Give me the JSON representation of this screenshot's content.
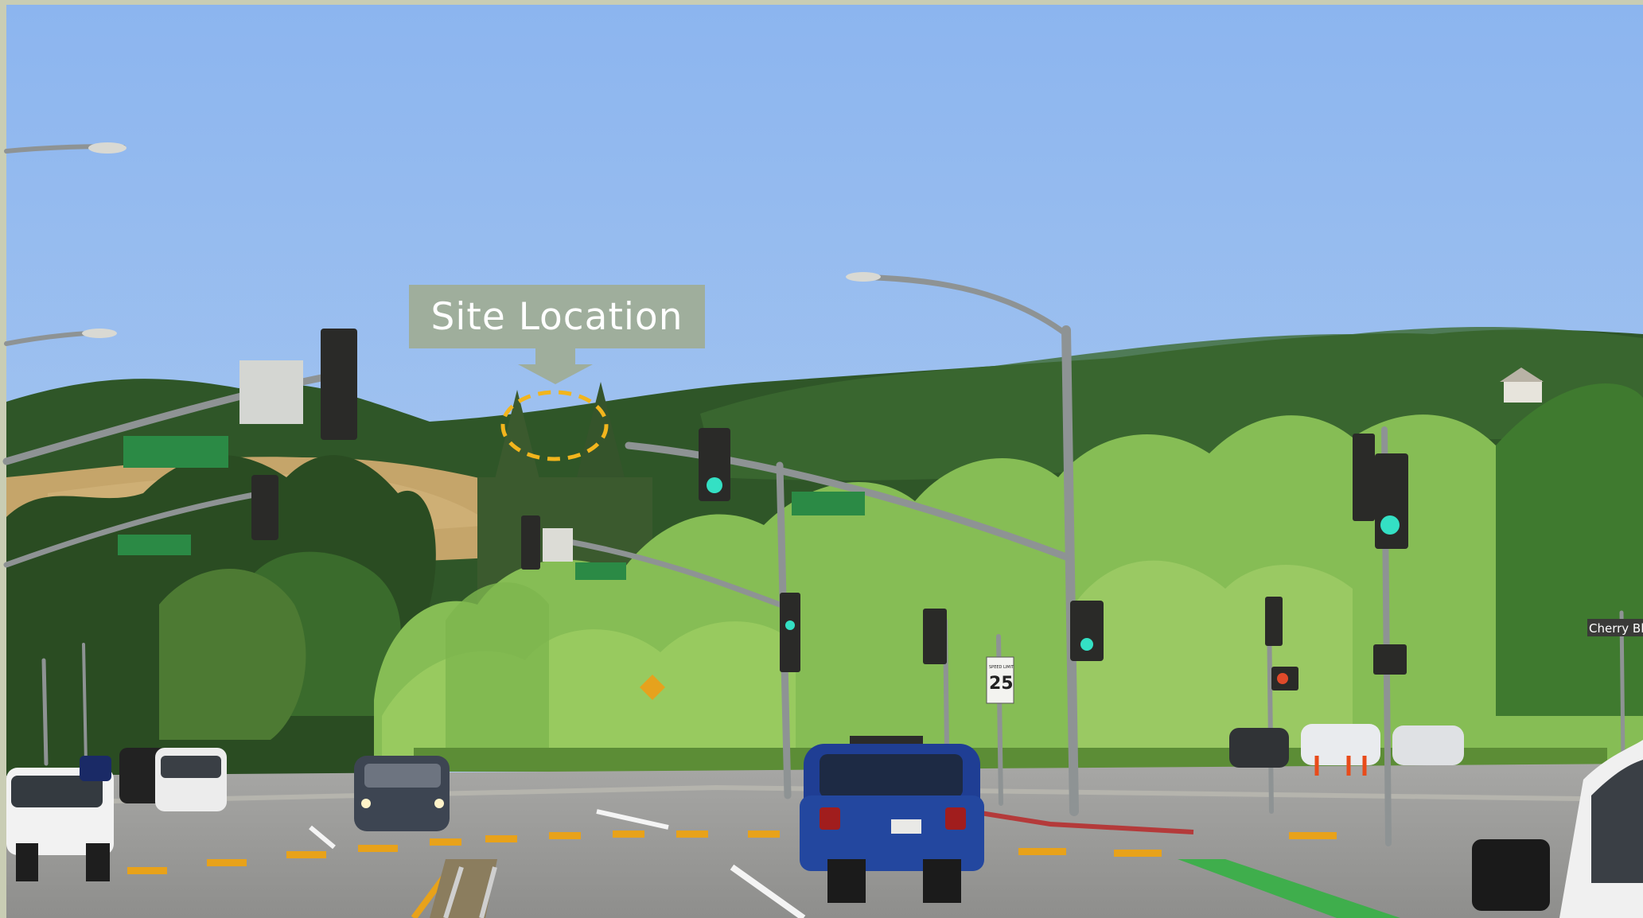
{
  "image": {
    "description_free": true,
    "colors": {
      "sky_top": "#8fb7f0",
      "sky_bottom": "#a9c8ee",
      "hill_dark": "#2f5a2a",
      "hill_dry": "#c9aa6b",
      "tree_light": "#8fc45a",
      "road": "#9a9a9a",
      "lane_yellow": "#e8a21a",
      "bike_lane": "#3fae4c",
      "callout_bg": "#9fae9c",
      "dashed_circle": "#f2b51d",
      "top_bar": "#c9cdb4"
    }
  },
  "callout": {
    "label": "Site Location"
  },
  "signs": {
    "speed_limit_value": "25",
    "speed_limit_caption": "SPEED LIMIT",
    "street_sign": "Cherry Bloss"
  }
}
